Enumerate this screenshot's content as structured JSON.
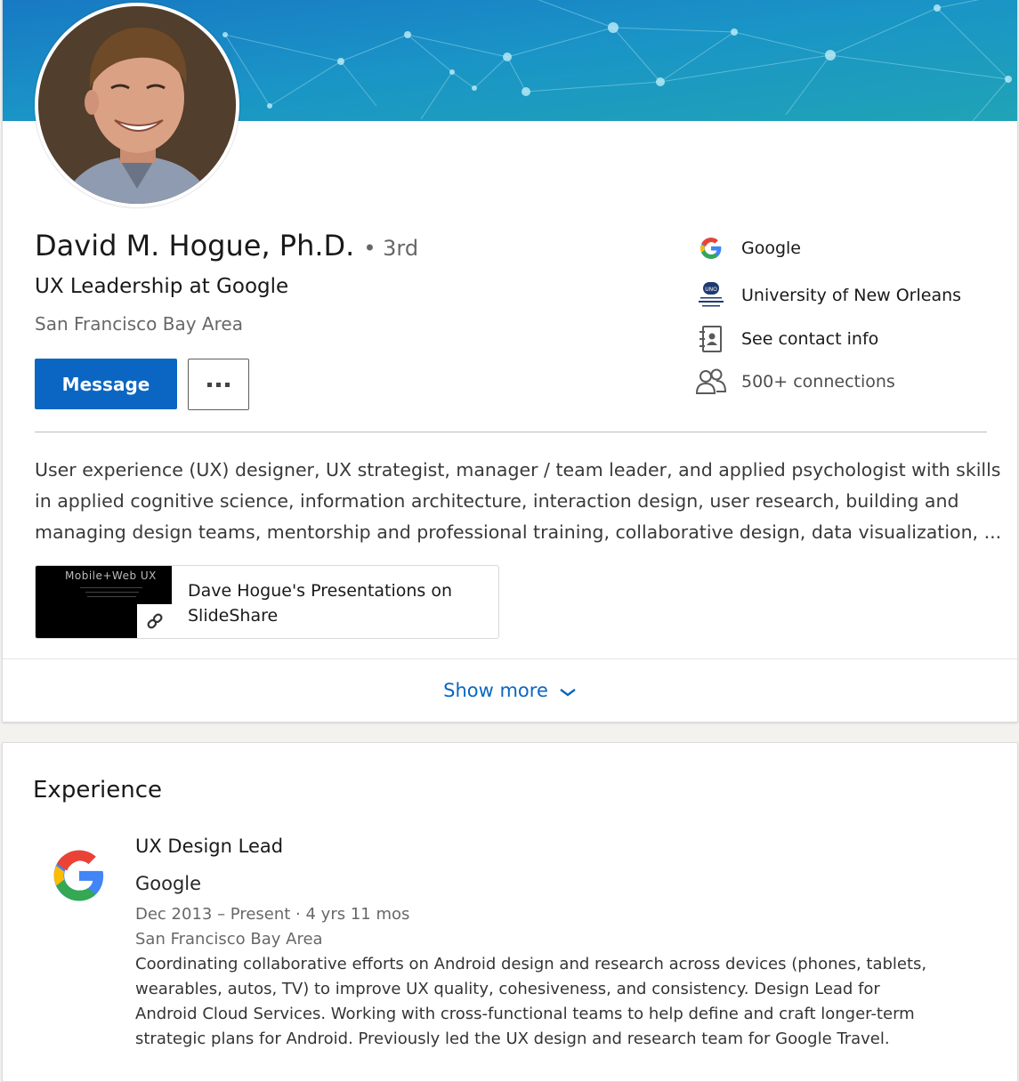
{
  "profile": {
    "name": "David M. Hogue, Ph.D.",
    "degree": "• 3rd",
    "headline": "UX Leadership at Google",
    "location": "San Francisco Bay Area",
    "message_label": "Message",
    "more_icon": "ellipsis-icon",
    "side_items": [
      {
        "icon": "google-logo-icon",
        "label": "Google"
      },
      {
        "icon": "university-logo-icon",
        "label": "University of New Orleans"
      },
      {
        "icon": "contact-book-icon",
        "label": "See contact info"
      },
      {
        "icon": "connections-icon",
        "label": "500+ connections"
      }
    ],
    "summary_lines": [
      "User experience (UX) designer, UX strategist, manager / team leader, and applied psychologist with skills",
      "in applied cognitive science, information architecture, interaction design, user research, building and",
      "managing design teams, mentorship and professional training, collaborative design, data visualization, ..."
    ],
    "media": {
      "thumb_title": "Mobile+Web UX",
      "title": "Dave Hogue's Presentations on SlideShare"
    },
    "show_more_label": "Show more"
  },
  "experience": {
    "heading": "Experience",
    "items": [
      {
        "title": "UX Design Lead",
        "company": "Google",
        "dates": "Dec 2013 – Present · 4 yrs 11 mos",
        "location": "San Francisco Bay Area",
        "description_lines": [
          "Coordinating collaborative efforts on Android design and research across devices (phones, tablets,",
          "wearables, autos, TV) to improve UX quality, cohesiveness, and consistency. Design Lead for",
          "Android Cloud Services. Working with cross-functional teams to help define and craft longer-term",
          "strategic plans for Android. Previously led the UX design and research team for Google Travel."
        ]
      }
    ]
  },
  "colors": {
    "brand_blue": "#0a66c2",
    "banner_start": "#1d8fc6",
    "banner_end": "#1f9db5"
  }
}
